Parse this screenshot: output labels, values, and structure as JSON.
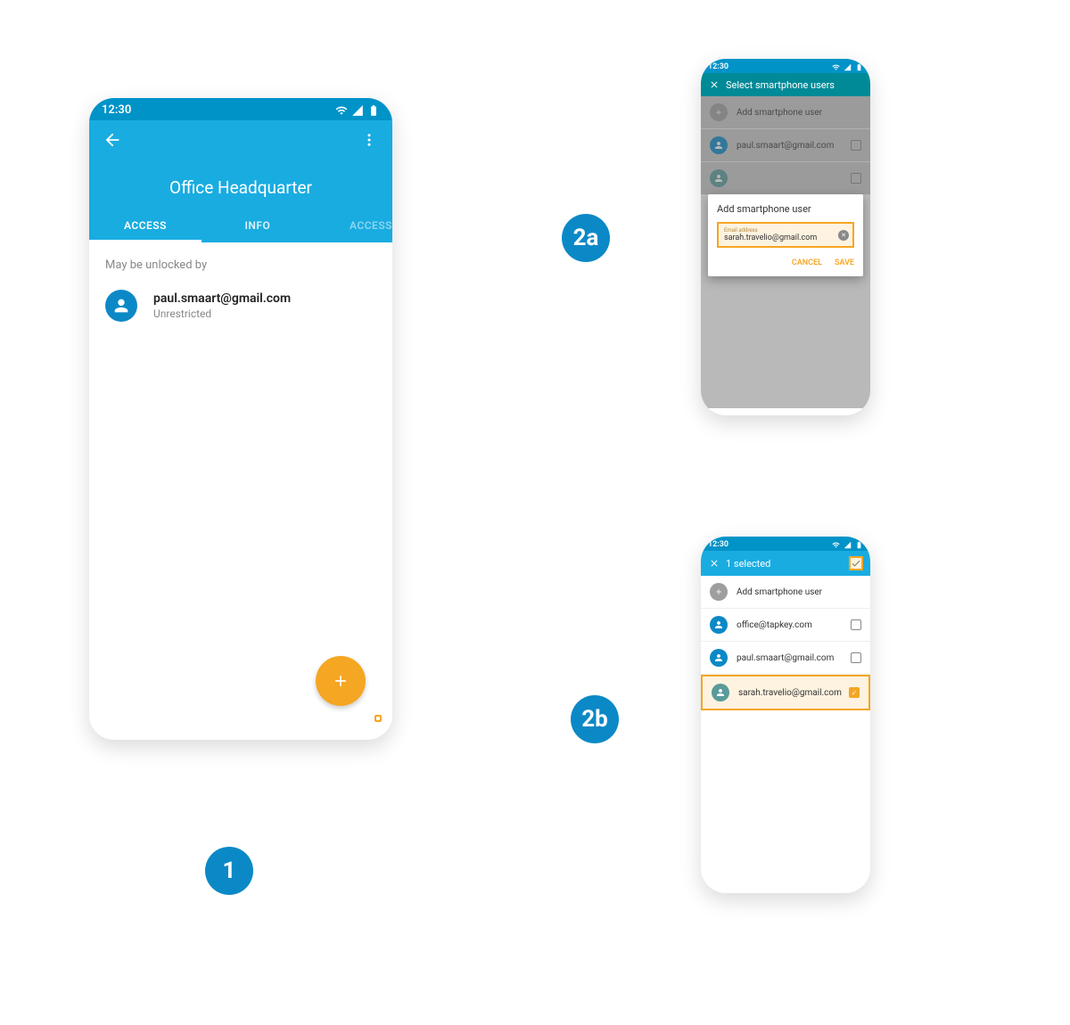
{
  "status_time": "12:30",
  "steps": {
    "one": "1",
    "two_a": "2a",
    "two_b": "2b"
  },
  "phone1": {
    "title": "Office Headquarter",
    "tabs": [
      "ACCESS",
      "INFO",
      "ACCESS"
    ],
    "section_label": "May be unlocked by",
    "user": {
      "email": "paul.smaart@gmail.com",
      "sub": "Unrestricted"
    }
  },
  "phone2a": {
    "header": "Select smartphone users",
    "add_label": "Add smartphone user",
    "list": [
      "paul.smaart@gmail.com"
    ],
    "dialog": {
      "title": "Add smartphone user",
      "input_label": "Email address",
      "input_value": "sarah.travelio@gmail.com",
      "cancel": "CANCEL",
      "save": "SAVE"
    }
  },
  "phone2b": {
    "header": "1 selected",
    "add_label": "Add smartphone user",
    "list": [
      {
        "email": "office@tapkey.com",
        "checked": false
      },
      {
        "email": "paul.smaart@gmail.com",
        "checked": false
      },
      {
        "email": "sarah.travelio@gmail.com",
        "checked": true
      }
    ]
  }
}
